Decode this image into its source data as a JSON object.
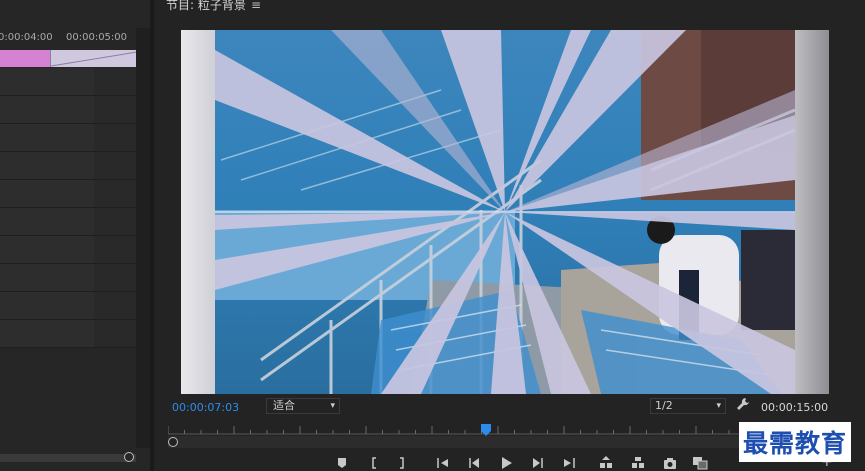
{
  "timeline": {
    "time_left": "0:00:04:00",
    "time_right": "00:00:05:00"
  },
  "monitor": {
    "title": "节目: 粒子背景",
    "menu_icon": "≡",
    "current_time": "00:00:07:03",
    "fit_label": "适合",
    "resolution": "1/2",
    "duration": "00:00:15:00",
    "playhead_progress": 0.48
  },
  "transport": {
    "icons": [
      "add-marker-icon",
      "mark-in-icon",
      "mark-out-icon",
      "go-to-in-icon",
      "step-back-icon",
      "play-icon",
      "step-forward-icon",
      "go-to-out-icon",
      "lift-icon",
      "extract-icon",
      "export-frame-icon",
      "compare-view-icon",
      "add-button-icon"
    ]
  },
  "watermark": {
    "text": "最需教育"
  },
  "colors": {
    "accent_blue": "#2d8ceb",
    "clip_pink": "#d682d2",
    "clip_lavender": "#cfc8de",
    "watermark_blue": "#1e4fb0"
  }
}
